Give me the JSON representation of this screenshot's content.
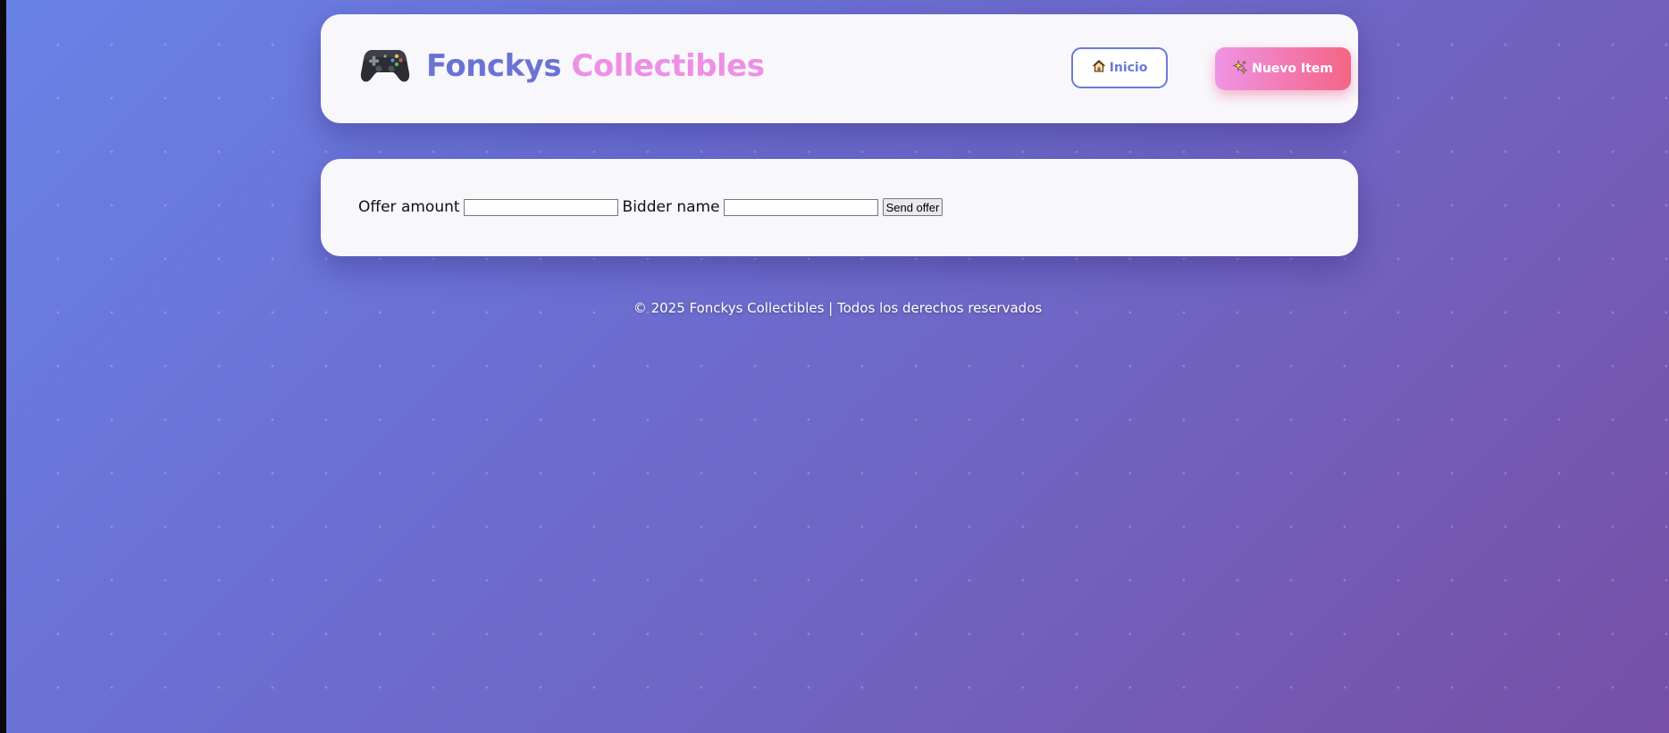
{
  "header": {
    "logo_icon": "gamepad-icon",
    "brand_part1": "Fonckys",
    "brand_part2": "Collectibles",
    "nav": {
      "inicio_icon": "house-icon",
      "inicio_label": "Inicio",
      "nuevo_icon": "sparkles-icon",
      "nuevo_label": "Nuevo Item"
    }
  },
  "offer_form": {
    "amount_label": "Offer amount",
    "amount_value": "",
    "bidder_label": "Bidder name",
    "bidder_value": "",
    "submit_label": "Send offer"
  },
  "footer": {
    "text": "© 2025 Fonckys Collectibles | Todos los derechos reservados"
  },
  "colors": {
    "brand_blue": "#6a73d4",
    "brand_pink": "#ee8fe6",
    "button_gradient_start": "#ef93e5",
    "button_gradient_end": "#f56484",
    "background_start": "#6a82e6",
    "background_end": "#774fa6"
  }
}
